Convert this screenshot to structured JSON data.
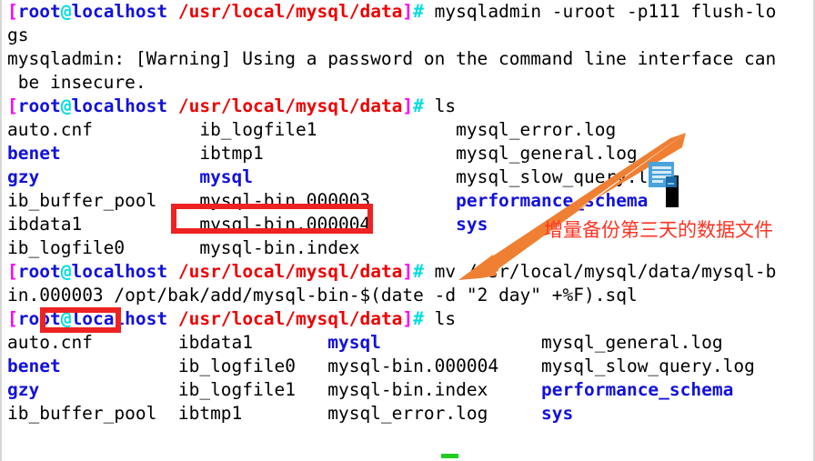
{
  "terminal": {
    "prompt": {
      "open_bracket": "[",
      "user": "root",
      "at": "@",
      "host": "localhost",
      "path": " /usr/local/mysql/data",
      "close_bracket": "]",
      "hash": "#"
    },
    "commands": {
      "flush_logs": " mysqladmin -uroot -p111 flush-lo",
      "flush_logs_wrap": "gs",
      "warning_line": "mysqladmin: [Warning] Using a password on the command line interface can",
      "warning_wrap": " be insecure.",
      "ls": " ls",
      "mv": " mv /usr/local/mysql/data/mysql-b",
      "mv_wrap_prefix": "in.",
      "mv_wrap_highlight": "000003",
      "mv_wrap_suffix": " /opt/bak/add/mysql-bin-$(date -d \"2 day\" +%F).sql"
    },
    "listing_first": [
      [
        {
          "text": "auto.cnf",
          "type": "file"
        },
        {
          "text": "ib_logfile1",
          "type": "file"
        },
        {
          "text": "mysql_error.log",
          "type": "file"
        }
      ],
      [
        {
          "text": "benet",
          "type": "dir"
        },
        {
          "text": "ibtmp1",
          "type": "file"
        },
        {
          "text": "mysql_general.log",
          "type": "file"
        }
      ],
      [
        {
          "text": "gzy",
          "type": "dir"
        },
        {
          "text": "mysql",
          "type": "dir"
        },
        {
          "text": "mysql_slow_query.log",
          "type": "file"
        }
      ],
      [
        {
          "text": "ib_buffer_pool",
          "type": "file"
        },
        {
          "text": "mysql-bin.000003",
          "type": "file"
        },
        {
          "text": "performance_schema",
          "type": "dir"
        }
      ],
      [
        {
          "text": "ibdata1",
          "type": "file"
        },
        {
          "text": "mysql-bin.000004",
          "type": "file"
        },
        {
          "text": "sys",
          "type": "dir"
        }
      ],
      [
        {
          "text": "ib_logfile0",
          "type": "file"
        },
        {
          "text": "mysql-bin.index",
          "type": "file"
        },
        {
          "text": "",
          "type": "file"
        }
      ]
    ],
    "listing_second": [
      [
        {
          "text": "auto.cnf",
          "type": "file"
        },
        {
          "text": "ibdata1",
          "type": "file"
        },
        {
          "text": "mysql",
          "type": "dir"
        },
        {
          "text": "mysql_general.log",
          "type": "file"
        }
      ],
      [
        {
          "text": "benet",
          "type": "dir"
        },
        {
          "text": "ib_logfile0",
          "type": "file"
        },
        {
          "text": "mysql-bin.000004",
          "type": "file"
        },
        {
          "text": "mysql_slow_query.log",
          "type": "file"
        }
      ],
      [
        {
          "text": "gzy",
          "type": "dir"
        },
        {
          "text": "ib_logfile1",
          "type": "file"
        },
        {
          "text": "mysql-bin.index",
          "type": "file"
        },
        {
          "text": "performance_schema",
          "type": "dir"
        }
      ],
      [
        {
          "text": "ib_buffer_pool",
          "type": "file"
        },
        {
          "text": "ibtmp1",
          "type": "file"
        },
        {
          "text": "mysql_error.log",
          "type": "file"
        },
        {
          "text": "sys",
          "type": "dir"
        }
      ]
    ]
  },
  "annotations": {
    "note_text": "增量备份第三天的数据文件",
    "note_color": "#ff3322",
    "highlight_color": "#ee2222",
    "arrow_color": "#ef8033",
    "highlighted_file": "mysql-bin.000003",
    "highlighted_suffix": "000003"
  },
  "colors": {
    "background": "#ffffff",
    "foreground": "#000000",
    "prompt_user": "#1111dd",
    "prompt_path": "#ee0000",
    "prompt_bracket": "#ff00ff",
    "prompt_at": "#00dddd",
    "directory": "#1111dd",
    "cursor": "#22cc22"
  }
}
